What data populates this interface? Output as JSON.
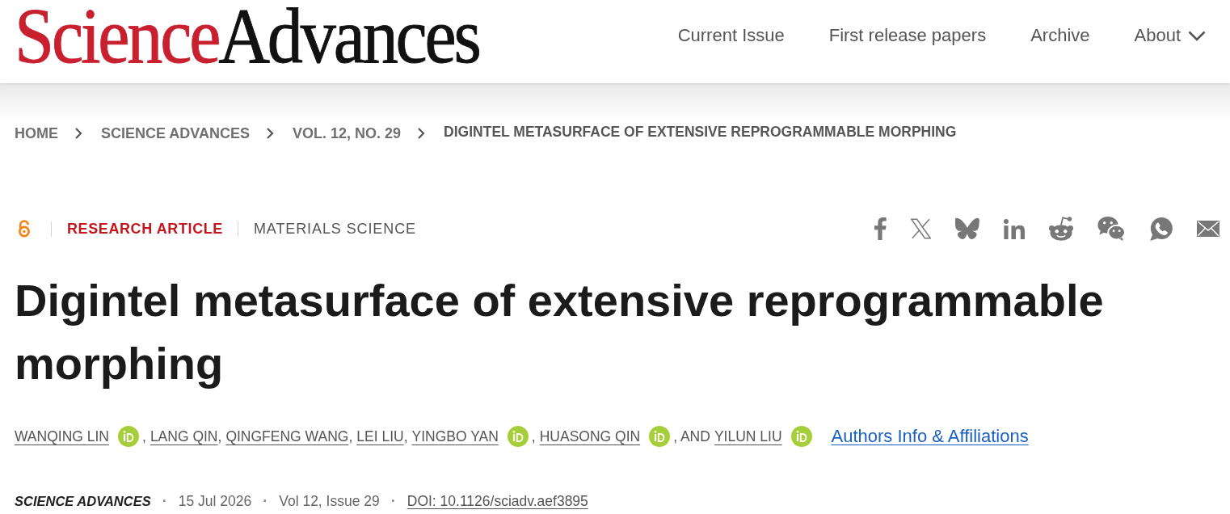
{
  "header": {
    "logo": {
      "first": "Science",
      "second": "Advances"
    },
    "nav": [
      {
        "label": "Current Issue",
        "kind": "link"
      },
      {
        "label": "First release papers",
        "kind": "link"
      },
      {
        "label": "Archive",
        "kind": "link"
      },
      {
        "label": "About",
        "kind": "menu"
      }
    ]
  },
  "breadcrumbs": [
    {
      "label": "HOME",
      "current": false
    },
    {
      "label": "SCIENCE ADVANCES",
      "current": false
    },
    {
      "label": "VOL. 12, NO. 29",
      "current": false
    },
    {
      "label": "DIGINTEL METASURFACE OF EXTENSIVE REPROGRAMMABLE MORPHING",
      "current": true
    }
  ],
  "article": {
    "type": "RESEARCH ARTICLE",
    "subject": "MATERIALS SCIENCE",
    "title": "Digintel metasurface of extensive reprogrammable morphing"
  },
  "authors": [
    {
      "name": "WANQING LIN",
      "orcid": true
    },
    {
      "separator": ",",
      "name": "LANG QIN",
      "orcid": false
    },
    {
      "separator": ",",
      "name": "QINGFENG WANG",
      "orcid": false
    },
    {
      "separator": ",",
      "name": "LEI LIU",
      "orcid": false
    },
    {
      "separator": ",",
      "name": "YINGBO YAN",
      "orcid": true
    },
    {
      "separator": ",",
      "name": "HUASONG QIN",
      "orcid": true
    },
    {
      "separator": ", AND",
      "name": "YILUN LIU",
      "orcid": true
    }
  ],
  "authors_link": "Authors Info & Affiliations",
  "meta": [
    {
      "kind": "journal",
      "text": "SCIENCE ADVANCES"
    },
    {
      "kind": "separator",
      "text": "·"
    },
    {
      "kind": "date",
      "text": "15 Jul 2026"
    },
    {
      "kind": "separator",
      "text": "·"
    },
    {
      "kind": "issue",
      "text": "Vol 12, Issue 29"
    },
    {
      "kind": "separator",
      "text": "·"
    },
    {
      "kind": "doi",
      "text": "DOI: 10.1126/sciadv.aef3895"
    }
  ]
}
